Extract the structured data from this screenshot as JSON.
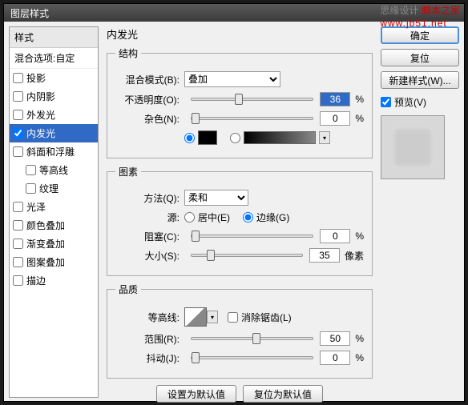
{
  "watermark": {
    "text1": "思缘设计",
    "text2": "脚本之家",
    "url": "www.jb51.net"
  },
  "title": "图层样式",
  "left": {
    "header": "样式",
    "subheader": "混合选项:自定",
    "items": [
      {
        "label": "投影",
        "checked": false,
        "selected": false
      },
      {
        "label": "内阴影",
        "checked": false,
        "selected": false
      },
      {
        "label": "外发光",
        "checked": false,
        "selected": false
      },
      {
        "label": "内发光",
        "checked": true,
        "selected": true
      },
      {
        "label": "斜面和浮雕",
        "checked": false,
        "selected": false
      },
      {
        "label": "等高线",
        "checked": false,
        "selected": false,
        "indent": true
      },
      {
        "label": "纹理",
        "checked": false,
        "selected": false,
        "indent": true
      },
      {
        "label": "光泽",
        "checked": false,
        "selected": false
      },
      {
        "label": "颜色叠加",
        "checked": false,
        "selected": false
      },
      {
        "label": "渐变叠加",
        "checked": false,
        "selected": false
      },
      {
        "label": "图案叠加",
        "checked": false,
        "selected": false
      },
      {
        "label": "描边",
        "checked": false,
        "selected": false
      }
    ]
  },
  "center": {
    "title": "内发光",
    "structure": {
      "legend": "结构",
      "blendLabel": "混合模式(B):",
      "blendValue": "叠加",
      "opacityLabel": "不透明度(O):",
      "opacityValue": "36",
      "opacityUnit": "%",
      "noiseLabel": "杂色(N):",
      "noiseValue": "0",
      "noiseUnit": "%"
    },
    "elements": {
      "legend": "图素",
      "methodLabel": "方法(Q):",
      "methodValue": "柔和",
      "sourceLabel": "源:",
      "sourceCenter": "居中(E)",
      "sourceEdge": "边缘(G)",
      "chokeLabel": "阻塞(C):",
      "chokeValue": "0",
      "chokeUnit": "%",
      "sizeLabel": "大小(S):",
      "sizeValue": "35",
      "sizeUnit": "像素"
    },
    "quality": {
      "legend": "品质",
      "contourLabel": "等高线:",
      "antialiasLabel": "消除锯齿(L)",
      "rangeLabel": "范围(R):",
      "rangeValue": "50",
      "rangeUnit": "%",
      "jitterLabel": "抖动(J):",
      "jitterValue": "0",
      "jitterUnit": "%"
    },
    "defaultBtn": "设置为默认值",
    "resetBtn": "复位为默认值"
  },
  "right": {
    "ok": "确定",
    "cancel": "复位",
    "newStyle": "新建样式(W)...",
    "previewLabel": "预览(V)"
  }
}
